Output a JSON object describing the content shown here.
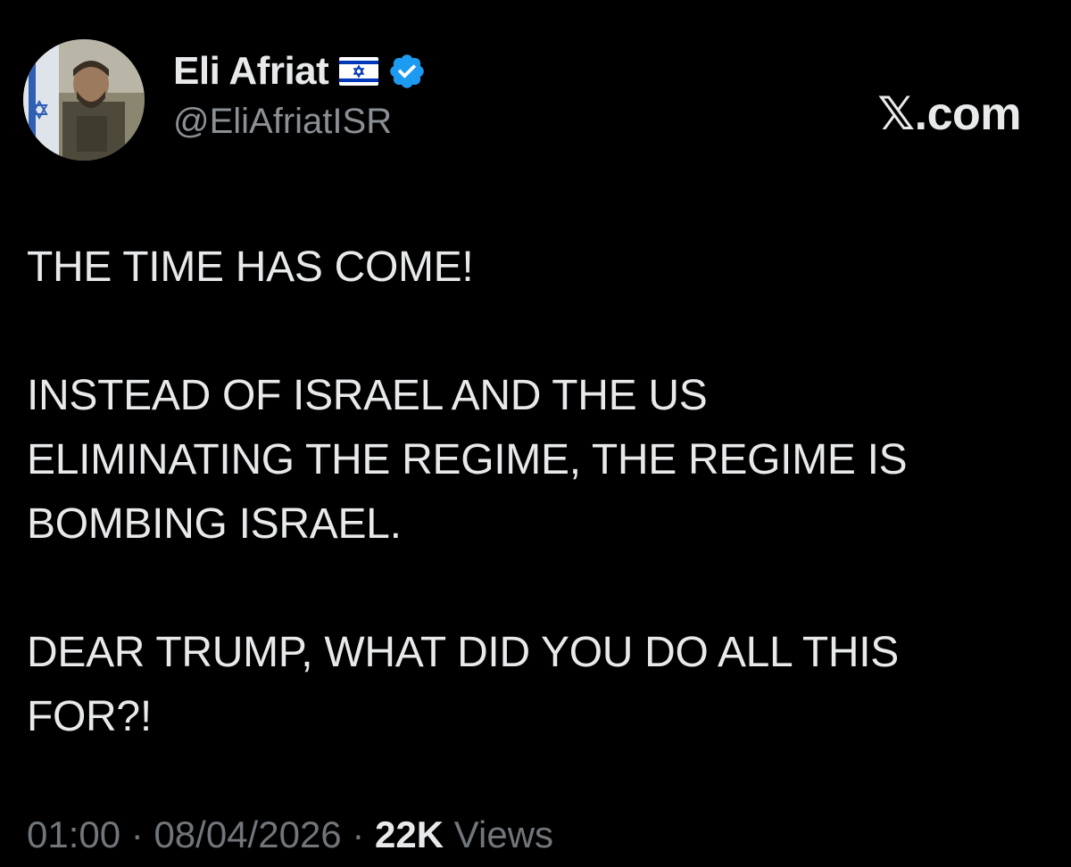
{
  "author": {
    "display_name": "Eli Afriat",
    "handle": "@EliAfriatISR"
  },
  "site_logo": "𝕏.com",
  "tweet": {
    "paragraphs": [
      [
        "THE TIME HAS COME!"
      ],
      [
        "INSTEAD OF ISRAEL AND THE US",
        "ELIMINATING THE REGIME, THE REGIME IS",
        "BOMBING ISRAEL."
      ],
      [
        "DEAR TRUMP, WHAT DID YOU DO ALL THIS",
        "FOR?!"
      ]
    ]
  },
  "meta": {
    "time": "01:00",
    "separator": "·",
    "date": "08/04/2026",
    "views_count": "22K",
    "views_label": "Views"
  },
  "icons": {
    "flag": "israel-flag-icon",
    "verified": "verified-badge-icon"
  },
  "colors": {
    "background": "#000000",
    "text": "#e7e9ea",
    "muted": "#71767b",
    "verified": "#1d9bf0",
    "flag_blue": "#0038b8"
  }
}
